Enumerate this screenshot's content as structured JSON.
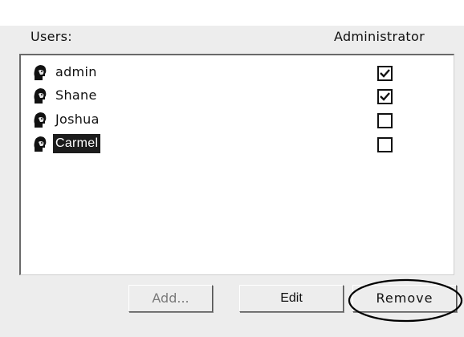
{
  "header": {
    "users_label": "Users:",
    "administrator_label": "Administrator"
  },
  "users": [
    {
      "name": "admin",
      "administrator": true,
      "selected": false
    },
    {
      "name": "Shane",
      "administrator": true,
      "selected": false
    },
    {
      "name": "Joshua",
      "administrator": false,
      "selected": false
    },
    {
      "name": "Carmel",
      "administrator": false,
      "selected": true
    }
  ],
  "buttons": {
    "add_label": "Add...",
    "edit_label": "Edit",
    "remove_label": "Remove"
  },
  "icons": {
    "user": "user-head-icon",
    "check": "check-icon"
  },
  "annotation": {
    "highlight": "remove-button",
    "color": "#000000"
  }
}
